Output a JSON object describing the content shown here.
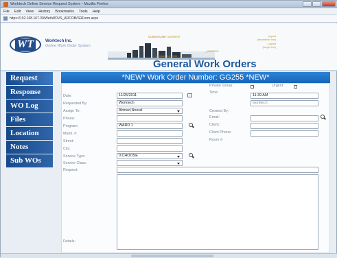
{
  "window": {
    "title": "Worktech Online Service Request System - Mozilla Firefox"
  },
  "menu": [
    "File",
    "Edit",
    "View",
    "History",
    "Bookmarks",
    "Tools",
    "Help"
  ],
  "address": {
    "url": "https://192.168.167.30/WebWOVS_ARCOB/SRForm.aspx"
  },
  "header": {
    "logo_text": "WT",
    "company": "Worktech Inc.",
    "subtitle": "Online Work Order System",
    "current_user_label": "Current User:",
    "current_user_value": "worktech",
    "right_lines": [
      "Logout",
      "(remember me)",
      "Logout",
      "(forget me)"
    ],
    "mid_text": "Version: 3.4.1006",
    "mid_text2": "_WEBEDS",
    "page_title": "General Work Orders"
  },
  "nav": [
    {
      "label": "Request",
      "active": true
    },
    {
      "label": "Response"
    },
    {
      "label": "WO Log"
    },
    {
      "label": "Files"
    },
    {
      "label": "Location"
    },
    {
      "label": "Notes"
    },
    {
      "label": "Sub WOs"
    }
  ],
  "banner": {
    "text": "*NEW*   Work Order Number:  GG255   *NEW*"
  },
  "form": {
    "date": {
      "label": "Date:",
      "value": "11/25/2011"
    },
    "requested_by": {
      "label": "Requested By:",
      "value": "Worktech"
    },
    "assign_to": {
      "label": "Assign To:",
      "value": "Ahmed,Nooral"
    },
    "phone": {
      "label": "Phone:",
      "value": ""
    },
    "program": {
      "label": "Program:",
      "value": "WARD 1"
    },
    "maint_no": {
      "label": "Maint. #:",
      "value": ""
    },
    "street": {
      "label": "Street:",
      "value": ""
    },
    "city": {
      "label": "City:",
      "value": ""
    },
    "service_type": {
      "label": "Service Type:",
      "value": "0:CHOOSE"
    },
    "service_class": {
      "label": "Service Class:",
      "value": ""
    },
    "request": {
      "label": "Request:",
      "value": ""
    },
    "details": {
      "label": "Details:"
    },
    "private_group": {
      "label": "Private Group:"
    },
    "urgent": {
      "label": "Urgent:"
    },
    "time": {
      "label": "Time:",
      "value": "11:39 AM"
    },
    "created_by": {
      "label": "Created By:",
      "value": "worktech"
    },
    "email": {
      "label": "Email:",
      "value": ""
    },
    "client": {
      "label": "Client:",
      "value": ""
    },
    "client_phone": {
      "label": "Client Phone:",
      "value": ""
    },
    "room_no": {
      "label": "Room #:"
    }
  },
  "colors": {
    "nav_bg": "#1f5496",
    "banner_bg": "#2a7bd0",
    "title": "#1d5aa0"
  }
}
